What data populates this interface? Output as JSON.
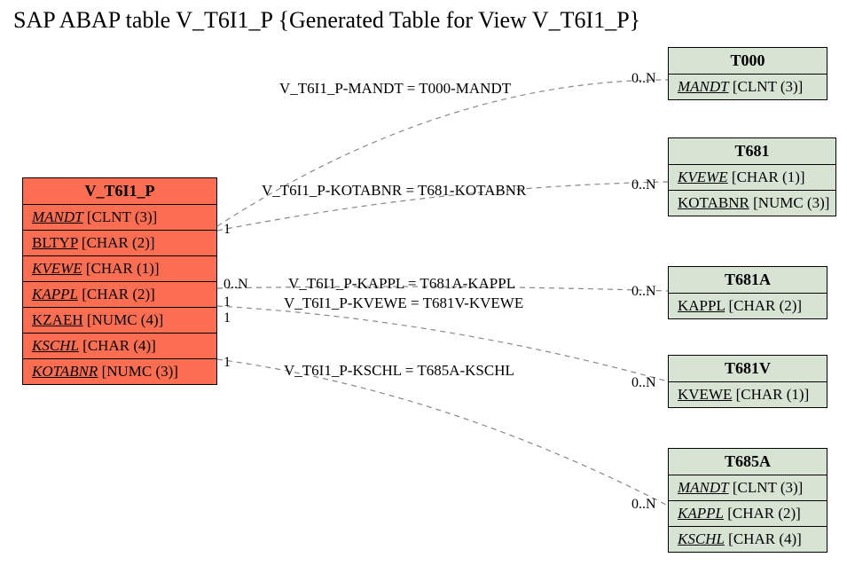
{
  "title": "SAP ABAP table V_T6I1_P {Generated Table for View V_T6I1_P}",
  "primary": {
    "name": "V_T6I1_P",
    "fields": [
      {
        "name": "MANDT",
        "type": "[CLNT (3)]",
        "key": true
      },
      {
        "name": "BLTYP",
        "type": "[CHAR (2)]",
        "key": false
      },
      {
        "name": "KVEWE",
        "type": "[CHAR (1)]",
        "key": true
      },
      {
        "name": "KAPPL",
        "type": "[CHAR (2)]",
        "key": true
      },
      {
        "name": "KZAEH",
        "type": "[NUMC (4)]",
        "key": false
      },
      {
        "name": "KSCHL",
        "type": "[CHAR (4)]",
        "key": true
      },
      {
        "name": "KOTABNR",
        "type": "[NUMC (3)]",
        "key": true
      }
    ]
  },
  "related": {
    "t000": {
      "name": "T000",
      "fields": [
        {
          "name": "MANDT",
          "type": "[CLNT (3)]",
          "key": true
        }
      ]
    },
    "t681": {
      "name": "T681",
      "fields": [
        {
          "name": "KVEWE",
          "type": "[CHAR (1)]",
          "key": true
        },
        {
          "name": "KOTABNR",
          "type": "[NUMC (3)]",
          "key": false
        }
      ]
    },
    "t681a": {
      "name": "T681A",
      "fields": [
        {
          "name": "KAPPL",
          "type": "[CHAR (2)]",
          "key": false
        }
      ]
    },
    "t681v": {
      "name": "T681V",
      "fields": [
        {
          "name": "KVEWE",
          "type": "[CHAR (1)]",
          "key": false
        }
      ]
    },
    "t685a": {
      "name": "T685A",
      "fields": [
        {
          "name": "MANDT",
          "type": "[CLNT (3)]",
          "key": true
        },
        {
          "name": "KAPPL",
          "type": "[CHAR (2)]",
          "key": true
        },
        {
          "name": "KSCHL",
          "type": "[CHAR (4)]",
          "key": true
        }
      ]
    }
  },
  "relations": {
    "r1": {
      "label": "V_T6I1_P-MANDT = T000-MANDT",
      "left": "",
      "right": "0..N"
    },
    "r2": {
      "label": "V_T6I1_P-KOTABNR = T681-KOTABNR",
      "left": "1",
      "right": "0..N"
    },
    "r3": {
      "label": "V_T6I1_P-KAPPL = T681A-KAPPL",
      "left": "0..N",
      "right": "0..N"
    },
    "r4": {
      "label": "V_T6I1_P-KVEWE = T681V-KVEWE",
      "left": "1",
      "right": ""
    },
    "r5": {
      "label": "V_T6I1_P-KSCHL = T685A-KSCHL",
      "left": "1",
      "right": "0..N"
    },
    "extra_left_card": "1",
    "t681v_right_card": "0..N",
    "t685a_right_card": "0..N"
  }
}
